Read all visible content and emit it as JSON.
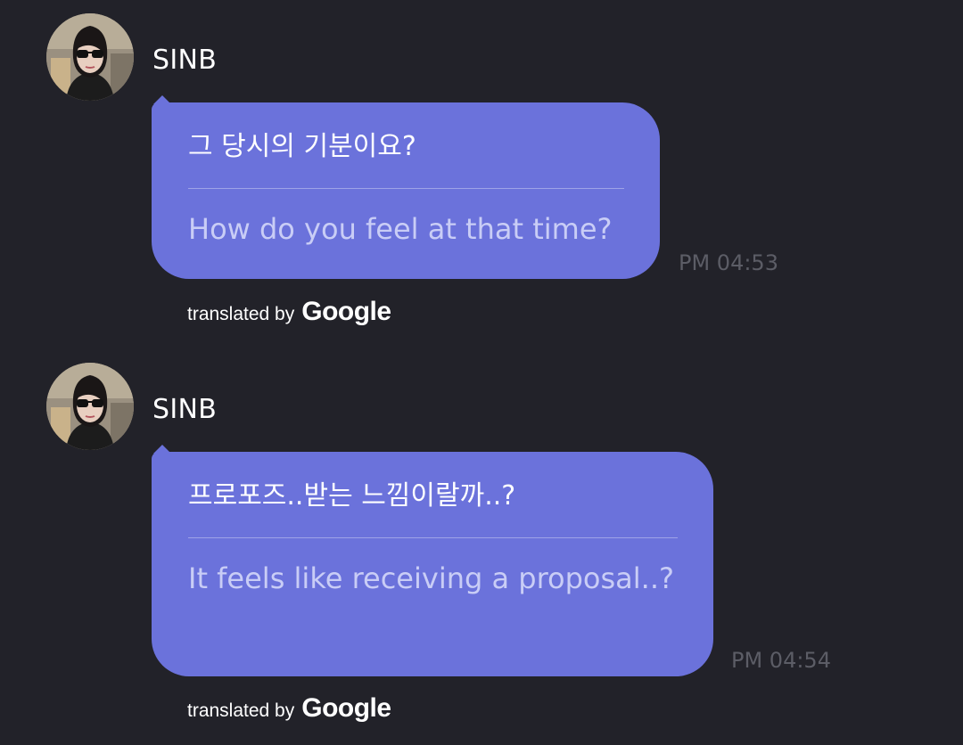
{
  "messages": [
    {
      "sender": "SINB",
      "original": "그 당시의 기분이요?",
      "translation": "How do you feel at that time?",
      "time": "PM 04:53",
      "credit": {
        "prefix": "translated by",
        "brand": "Google"
      }
    },
    {
      "sender": "SINB",
      "original": "프로포즈..받는 느낌이랄까..?",
      "translation": "It feels like receiving a proposal..?",
      "time": "PM 04:54",
      "credit": {
        "prefix": "translated by",
        "brand": "Google"
      }
    }
  ],
  "colors": {
    "background": "#222229",
    "bubble": "#6b72db",
    "translation_text": "#c9cdf6",
    "timestamp": "#5c5d66"
  },
  "icons": {
    "avatar": "profile-photo-avatar"
  }
}
